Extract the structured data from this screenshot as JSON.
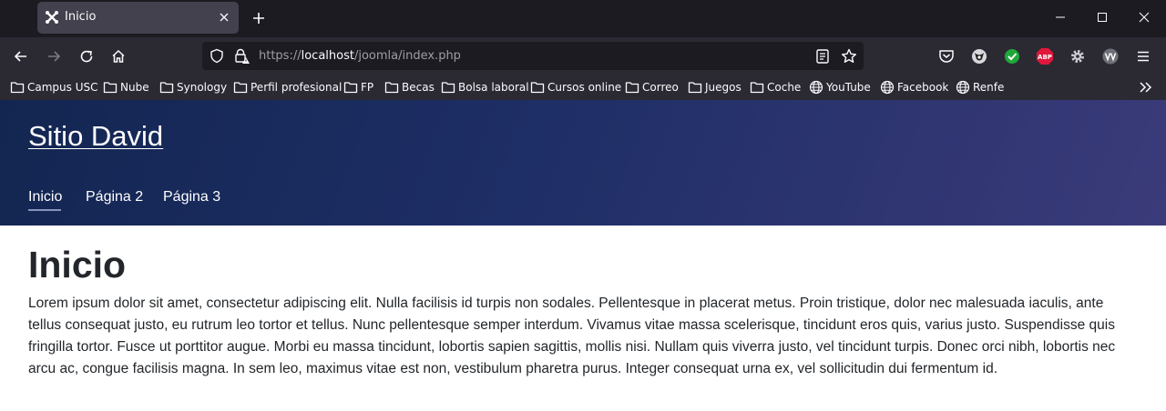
{
  "browser": {
    "tab": {
      "title": "Inicio",
      "favicon": "joomla-icon"
    },
    "url": {
      "scheme": "https://",
      "host": "localhost",
      "path": "/joomla/index.php"
    },
    "extensions": [
      "pocket-icon",
      "privacy-icon",
      "check-icon",
      "adblock-icon",
      "gear-icon",
      "vv-icon"
    ],
    "bookmarks": [
      {
        "label": "Campus USC",
        "icon": "folder-icon"
      },
      {
        "label": "Nube",
        "icon": "folder-icon"
      },
      {
        "label": "Synology",
        "icon": "folder-icon"
      },
      {
        "label": "Perfil profesional",
        "icon": "folder-icon"
      },
      {
        "label": "FP",
        "icon": "folder-icon"
      },
      {
        "label": "Becas",
        "icon": "folder-icon"
      },
      {
        "label": "Bolsa laboral",
        "icon": "folder-icon"
      },
      {
        "label": "Cursos online",
        "icon": "folder-icon"
      },
      {
        "label": "Correo",
        "icon": "folder-icon"
      },
      {
        "label": "Juegos",
        "icon": "folder-icon"
      },
      {
        "label": "Coche",
        "icon": "folder-icon"
      },
      {
        "label": "YouTube",
        "icon": "globe-icon"
      },
      {
        "label": "Facebook",
        "icon": "globe-icon"
      },
      {
        "label": "Renfe",
        "icon": "globe-icon"
      }
    ]
  },
  "site": {
    "title": "Sitio David",
    "menu": [
      {
        "label": "Inicio",
        "active": true
      },
      {
        "label": "Página 2",
        "active": false
      },
      {
        "label": "Página 3",
        "active": false
      }
    ]
  },
  "article": {
    "heading": "Inicio",
    "body": "Lorem ipsum dolor sit amet, consectetur adipiscing elit. Nulla facilisis id turpis non sodales. Pellentesque in placerat metus. Proin tristique, dolor nec malesuada iaculis, ante tellus consequat justo, eu rutrum leo tortor et tellus. Nunc pellentesque semper interdum. Vivamus vitae massa scelerisque, tincidunt eros quis, varius justo. Suspendisse quis fringilla tortor. Fusce ut porttitor augue. Morbi eu massa tincidunt, lobortis sapien sagittis, mollis nisi. Nullam quis viverra justo, vel tincidunt turpis. Donec orci nibh, lobortis nec arcu ac, congue facilisis magna. In sem leo, maximus vitae est non, vestibulum pharetra purus. Integer consequat urna ex, vel sollicitudin dui fermentum id."
  },
  "colors": {
    "tabstrip_bg": "#1c1b22",
    "toolbar_bg": "#2b2a33",
    "header_gradient_start": "#132651",
    "header_gradient_end": "#3b3b7a",
    "text_dark": "#22262a"
  }
}
